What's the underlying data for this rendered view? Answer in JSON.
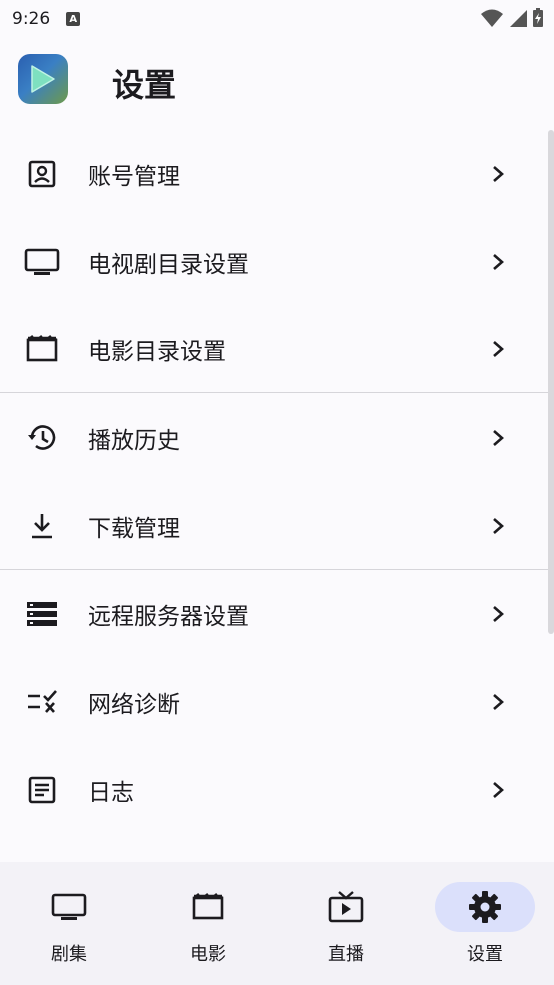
{
  "status_bar": {
    "time": "9:26",
    "notification_icon": "A"
  },
  "header": {
    "title": "设置"
  },
  "settings": [
    {
      "label": "账号管理",
      "icon": "account-box-icon"
    },
    {
      "label": "电视剧目录设置",
      "icon": "tv-icon"
    },
    {
      "label": "电影目录设置",
      "icon": "movie-clapper-icon"
    },
    {
      "label": "播放历史",
      "icon": "history-icon"
    },
    {
      "label": "下载管理",
      "icon": "download-icon"
    },
    {
      "label": "远程服务器设置",
      "icon": "server-icon"
    },
    {
      "label": "网络诊断",
      "icon": "checklist-icon"
    },
    {
      "label": "日志",
      "icon": "article-icon"
    }
  ],
  "bottom_nav": [
    {
      "label": "剧集",
      "icon": "tv-icon",
      "active": false
    },
    {
      "label": "电影",
      "icon": "movie-clapper-icon",
      "active": false
    },
    {
      "label": "直播",
      "icon": "live-tv-icon",
      "active": false
    },
    {
      "label": "设置",
      "icon": "gear-icon",
      "active": true
    }
  ],
  "colors": {
    "active_pill": "#dbe0fb",
    "background": "#fbfafd",
    "nav_background": "#f3f2f7"
  }
}
